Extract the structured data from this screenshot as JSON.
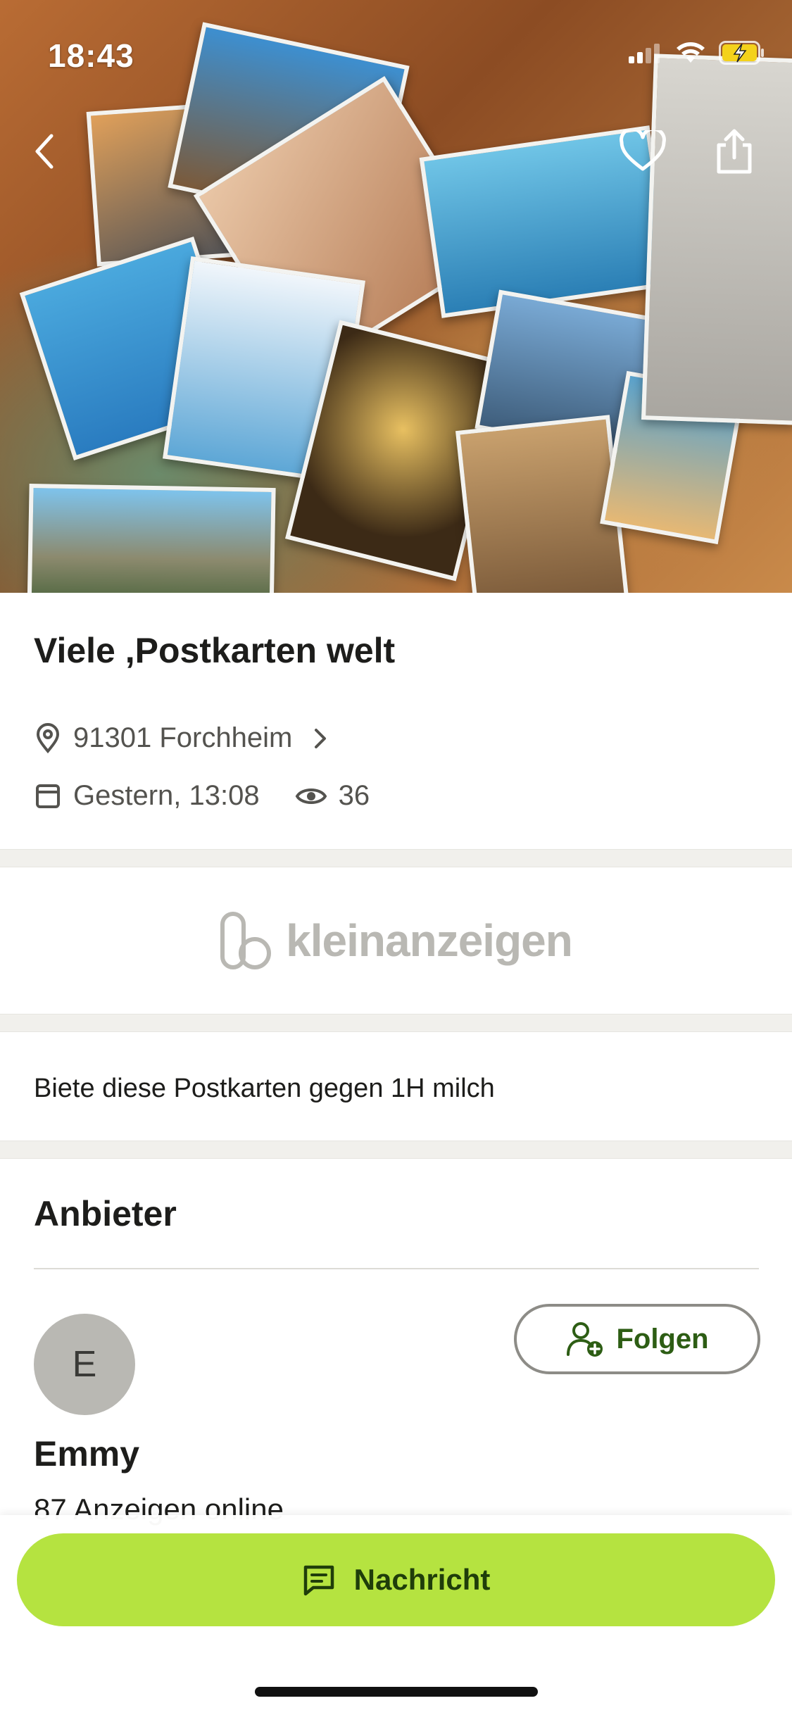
{
  "status_bar": {
    "time": "18:43",
    "icons": [
      "signal-icon",
      "wifi-icon",
      "battery-charging-icon"
    ]
  },
  "hero": {
    "image_description_icon": "postcards-photo",
    "actions": [
      "back-icon",
      "heart-icon",
      "share-icon"
    ]
  },
  "listing": {
    "title": "Viele ,Postkarten welt",
    "location": "91301 Forchheim",
    "date": "Gestern, 13:08",
    "views": "36"
  },
  "brand": {
    "logo_text": "kleinanzeigen"
  },
  "description": "Biete diese Postkarten gegen 1H milch",
  "seller": {
    "section_title": "Anbieter",
    "avatar_initial": "E",
    "name": "Emmy",
    "ads_online": "87 Anzeigen online",
    "follow_label": "Folgen"
  },
  "bottom": {
    "message_label": "Nachricht"
  },
  "colors": {
    "accent": "#b5e340",
    "accent_text": "#1f3d0a",
    "follow_text": "#2d5d14",
    "muted": "#54534f"
  }
}
